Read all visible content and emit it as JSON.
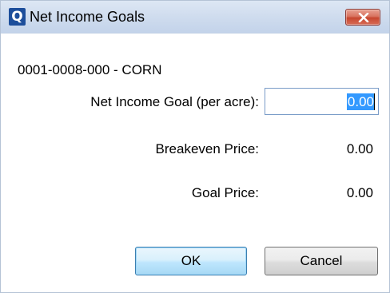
{
  "window": {
    "title": "Net Income Goals",
    "app_icon_letter": "Q"
  },
  "dialog": {
    "field_code": "0001-0008-000 - CORN",
    "net_income_goal_label": "Net Income Goal (per acre):",
    "net_income_goal_value": "0.00",
    "breakeven_price_label": "Breakeven Price:",
    "breakeven_price_value": "0.00",
    "goal_price_label": "Goal Price:",
    "goal_price_value": "0.00"
  },
  "buttons": {
    "ok_label": "OK",
    "cancel_label": "Cancel"
  },
  "colors": {
    "titlebar": "#cfdcee",
    "close_button": "#c7462f",
    "selection": "#3399ff",
    "app_icon": "#1d4e9b"
  },
  "icons": {
    "app": "quicken-q-icon",
    "close": "close-icon"
  }
}
